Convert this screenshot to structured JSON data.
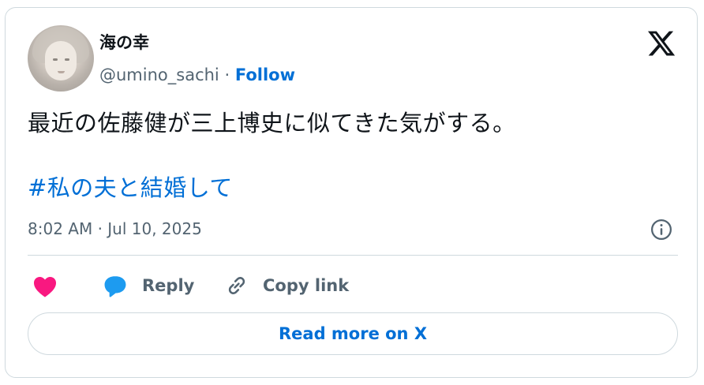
{
  "author": {
    "name": "海の幸",
    "handle": "@umino_sachi",
    "separator": "·",
    "follow_label": "Follow"
  },
  "tweet": {
    "text": "最近の佐藤健が三上博史に似てきた気がする。",
    "hashtag": "#私の夫と結婚して",
    "timestamp": "8:02 AM · Jul 10, 2025"
  },
  "actions": {
    "reply_label": "Reply",
    "copy_link_label": "Copy link"
  },
  "footer": {
    "read_more_label": "Read more on X"
  },
  "icons": {
    "platform": "x-logo-icon",
    "info": "info-icon",
    "like": "heart-icon",
    "reply": "speech-bubble-icon",
    "copy": "link-icon"
  },
  "colors": {
    "accent": "#006fd6",
    "heart": "#f91880",
    "reply_bubble": "#1d9bf0",
    "muted_text": "#536471",
    "border": "#cfd9de"
  }
}
